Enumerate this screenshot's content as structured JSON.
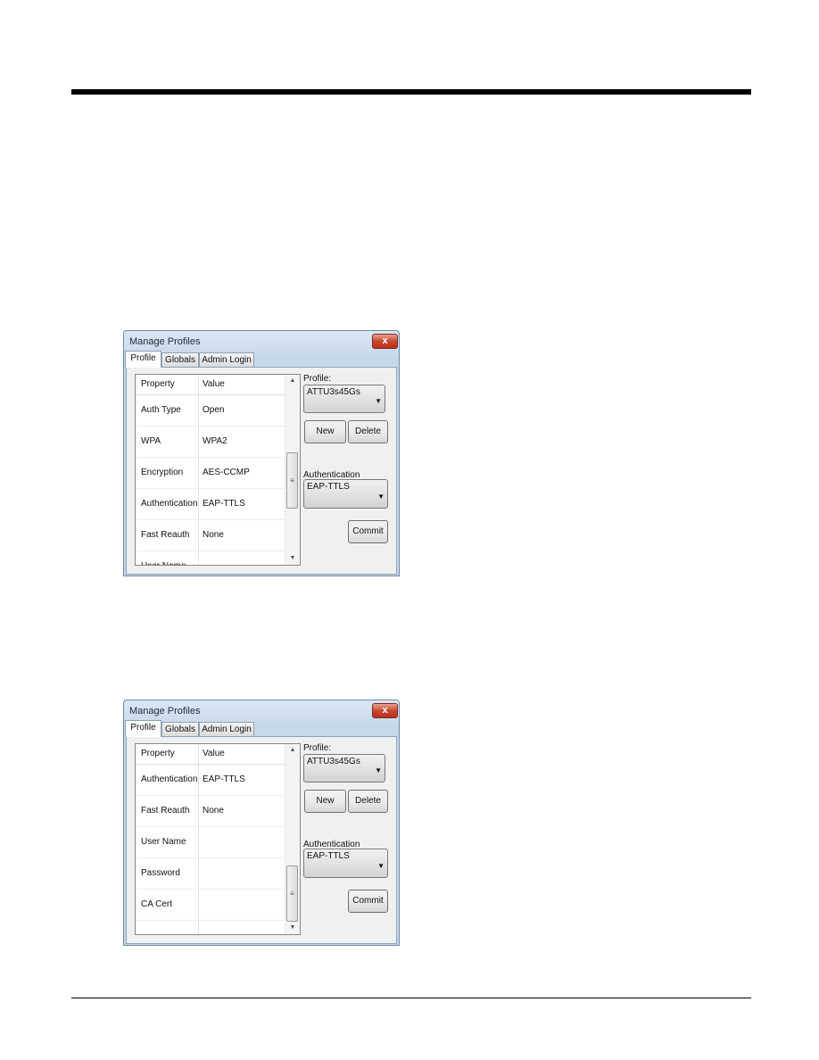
{
  "dialogs": [
    {
      "title": "Manage Profiles",
      "tabs": [
        "Profile",
        "Globals",
        "Admin Login"
      ],
      "columns": [
        "Property",
        "Value"
      ],
      "rows": [
        [
          "Auth Type",
          "Open"
        ],
        [
          "WPA",
          "WPA2"
        ],
        [
          "Encryption",
          "AES-CCMP"
        ],
        [
          "Authentication",
          "EAP-TTLS"
        ],
        [
          "Fast Reauth",
          "None"
        ],
        [
          "User Name",
          ""
        ]
      ],
      "scroll_position": 0.6,
      "profile_label": "Profile:",
      "profile_value": "ATTU3s45Gs",
      "new_label": "New",
      "delete_label": "Delete",
      "auth_label": "Authentication",
      "auth_value": "EAP-TTLS",
      "commit_label": "Commit",
      "close_glyph": "x"
    },
    {
      "title": "Manage Profiles",
      "tabs": [
        "Profile",
        "Globals",
        "Admin Login"
      ],
      "columns": [
        "Property",
        "Value"
      ],
      "rows": [
        [
          "Authentication",
          "EAP-TTLS"
        ],
        [
          "Fast Reauth",
          "None"
        ],
        [
          "User Name",
          ""
        ],
        [
          "Password",
          ""
        ],
        [
          "CA Cert",
          ""
        ]
      ],
      "scroll_position": 1.0,
      "profile_label": "Profile:",
      "profile_value": "ATTU3s45Gs",
      "new_label": "New",
      "delete_label": "Delete",
      "auth_label": "Authentication",
      "auth_value": "EAP-TTLS",
      "commit_label": "Commit",
      "close_glyph": "x"
    }
  ]
}
